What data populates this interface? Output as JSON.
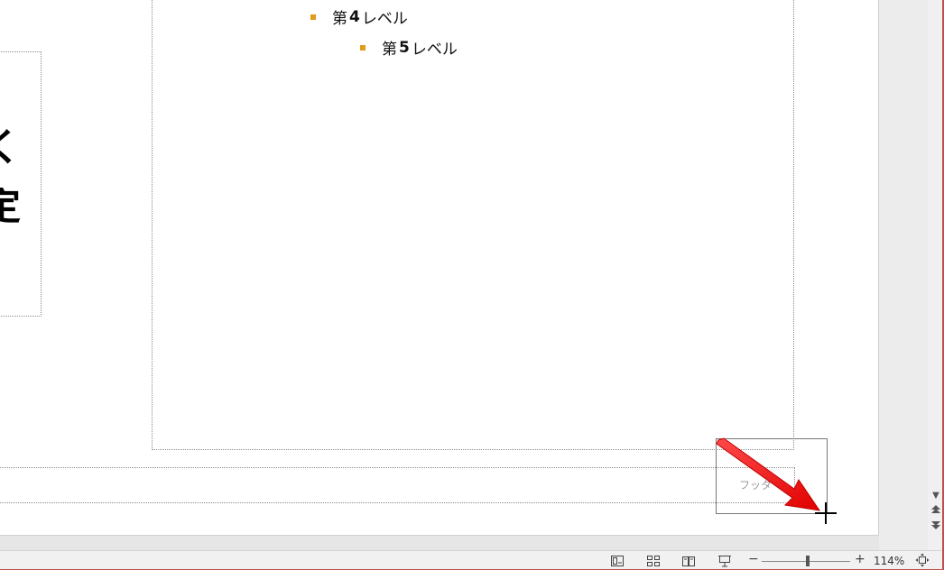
{
  "slide": {
    "left_glyphs": [
      "く",
      "定"
    ],
    "bullets": [
      {
        "prefix": "第",
        "num": "4",
        "suffix": "レベル"
      },
      {
        "prefix": "第",
        "num": "5",
        "suffix": "レベル"
      }
    ],
    "footer_placeholder": "フッタ"
  },
  "scrollbar": {
    "icons": [
      "chevron-down-icon",
      "previous-slide-icon",
      "next-slide-icon"
    ]
  },
  "status_bar": {
    "views": [
      "normal-view-icon",
      "slide-sorter-icon",
      "reading-view-icon",
      "slideshow-icon"
    ],
    "zoom_minus": "−",
    "zoom_plus": "+",
    "zoom_level": "114%",
    "zoom_fraction": 0.52
  },
  "colors": {
    "bullet": "#e39a1b",
    "arrow": "#ff1a1a"
  }
}
